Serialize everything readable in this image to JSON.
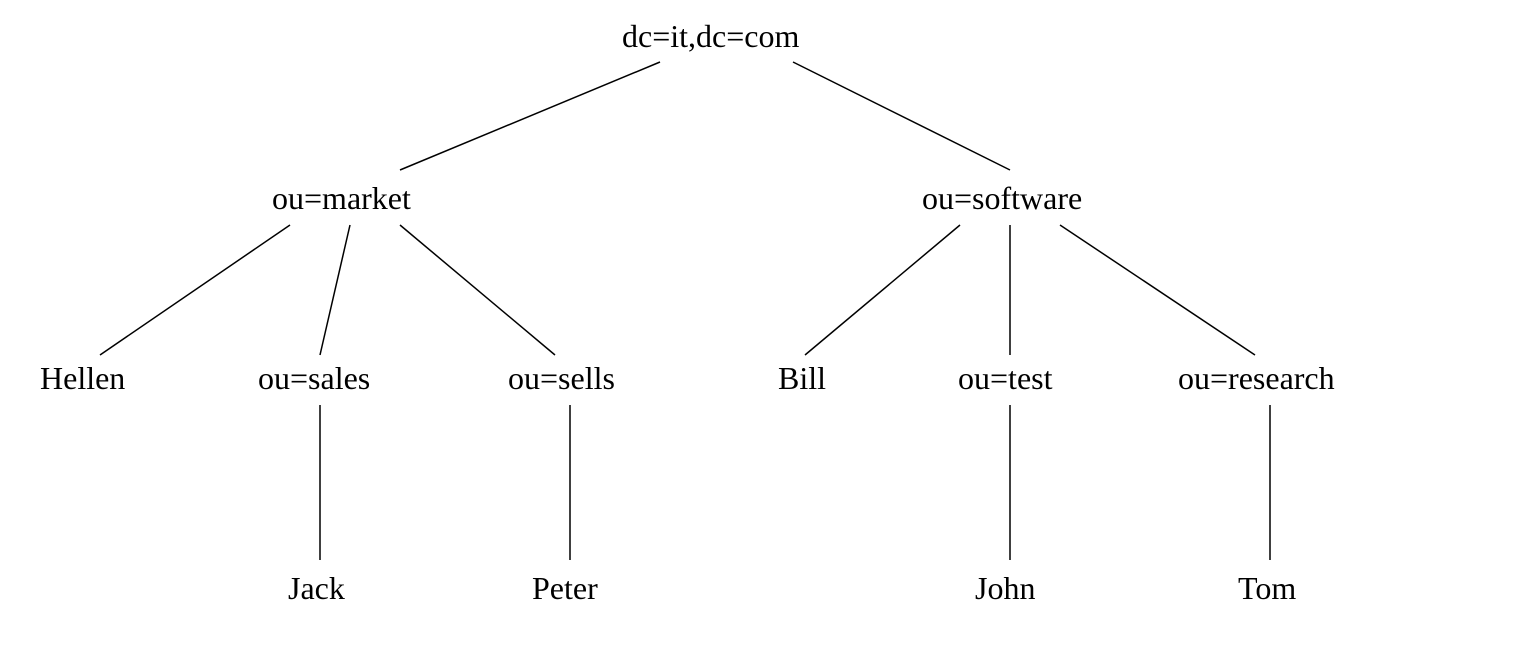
{
  "tree": {
    "root": "dc=it,dc=com",
    "level1": {
      "left": "ou=market",
      "right": "ou=software"
    },
    "level2": {
      "market_children": {
        "c1": "Hellen",
        "c2": "ou=sales",
        "c3": "ou=sells"
      },
      "software_children": {
        "c1": "Bill",
        "c2": "ou=test",
        "c3": "ou=research"
      }
    },
    "level3": {
      "sales_child": "Jack",
      "sells_child": "Peter",
      "test_child": "John",
      "research_child": "Tom"
    }
  }
}
